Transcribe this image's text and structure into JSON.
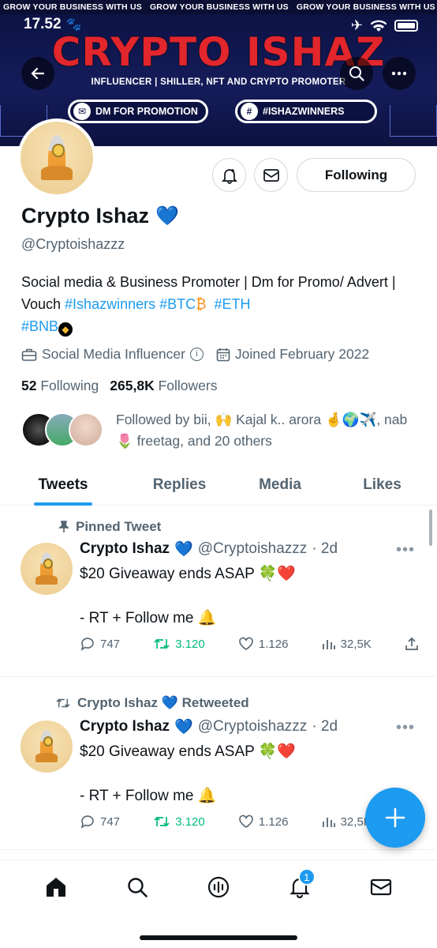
{
  "status_bar": {
    "time": "17.52"
  },
  "banner": {
    "ticker": [
      "GROW YOUR BUSINESS WITH US",
      "GROW YOUR BUSINESS WITH US",
      "GROW YOUR BUSINESS WITH US"
    ],
    "brand": "CRYPTO ISHAZ",
    "tagline": "INFLUENCER | SHILLER, NFT AND CRYPTO PROMOTER",
    "pill_dm": "DM FOR PROMOTION",
    "pill_tag": "#ISHAZWINNERS"
  },
  "profile": {
    "following_label": "Following",
    "name": "Crypto Ishaz",
    "handle": "@Cryptoishazzz",
    "bio_text": "Social media & Business Promoter | Dm for Promo/ Advert | Vouch ",
    "bio_tag1": "#Ishazwinners",
    "bio_tag2": "#BTC",
    "bio_tag3": "#ETH",
    "bio_tag4": "#BNB",
    "category": "Social Media Influencer",
    "joined": "Joined February 2022",
    "following_count": "52",
    "following_word": "Following",
    "followers_count": "265,8K",
    "followers_word": "Followers",
    "followed_by": "Followed by bii, 🙌 Kajal k.. arora 🤞🌍✈️, nab 🌷 freetag, and 20 others"
  },
  "tabs": [
    "Tweets",
    "Replies",
    "Media",
    "Likes"
  ],
  "tweets": [
    {
      "context": "Pinned Tweet",
      "name": "Crypto Ishaz",
      "handle": "@Cryptoishazzz",
      "time": "· 2d",
      "text": "$20 Giveaway ends ASAP 🍀❤️\n\n- RT + Follow me 🔔",
      "replies": "747",
      "retweets": "3.120",
      "likes": "1.126",
      "views": "32,5K"
    },
    {
      "context": "Crypto Ishaz 💙 Retweeted",
      "name": "Crypto Ishaz",
      "handle": "@Cryptoishazzz",
      "time": "· 2d",
      "text": "$20 Giveaway ends ASAP 🍀❤️\n\n- RT + Follow me 🔔",
      "replies": "747",
      "retweets": "3.120",
      "likes": "1.126",
      "views": "32,5K"
    }
  ],
  "nav": {
    "notifications_badge": "1"
  },
  "colors": {
    "accent": "#1d9bf0",
    "retweet": "#00ba7c",
    "brand_red": "#e1262c",
    "banner_bg": "#0b1140"
  }
}
